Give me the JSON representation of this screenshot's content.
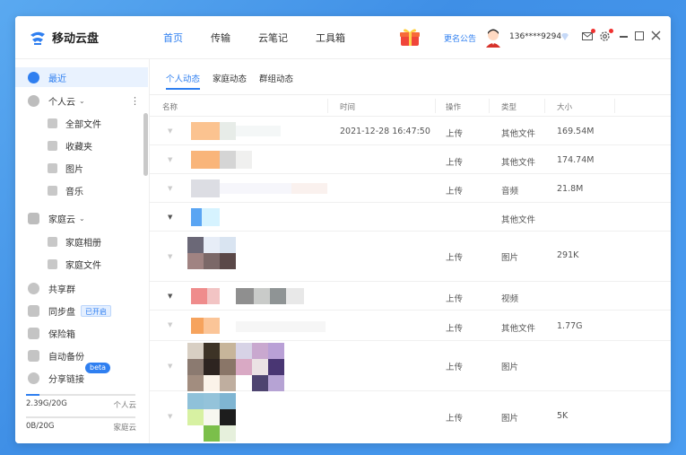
{
  "app": {
    "name": "移动云盘",
    "accent": "#2f7ff0"
  },
  "topnav": [
    {
      "label": "首页",
      "active": true
    },
    {
      "label": "传输",
      "active": false
    },
    {
      "label": "云笔记",
      "active": false
    },
    {
      "label": "工具箱",
      "active": false
    }
  ],
  "header": {
    "notice": "更名公告",
    "phone": "136****9294"
  },
  "sidebar": {
    "recent": "最近",
    "personal_cloud": "个人云",
    "all_files": "全部文件",
    "favorites": "收藏夹",
    "pictures": "图片",
    "music": "音乐",
    "family_cloud": "家庭云",
    "family_album": "家庭相册",
    "family_files": "家庭文件",
    "shared_group": "共享群",
    "sync_disk": "同步盘",
    "sync_badge": "已开启",
    "safe_box": "保险箱",
    "auto_backup": "自动备份",
    "beta": "beta",
    "share_link": "分享链接",
    "quota_personal": {
      "text": "2.39G/20G",
      "kind": "个人云",
      "fill": 0.12
    },
    "quota_family": {
      "text": "0B/20G",
      "kind": "家庭云",
      "fill": 0.0
    }
  },
  "tabs": [
    {
      "label": "个人动态",
      "active": true
    },
    {
      "label": "家庭动态",
      "active": false
    },
    {
      "label": "群组动态",
      "active": false
    }
  ],
  "table": {
    "headers": [
      "名称",
      "时间",
      "操作",
      "类型",
      "大小"
    ],
    "rows": [
      {
        "time": "2021-12-28 16:47:50",
        "action": "上传",
        "type": "其他文件",
        "size": "169.54M"
      },
      {
        "time": "",
        "action": "上传",
        "type": "其他文件",
        "size": "174.74M"
      },
      {
        "time": "",
        "action": "上传",
        "type": "音频",
        "size": "21.8M"
      },
      {
        "time": "",
        "action": "",
        "type": "其他文件",
        "size": ""
      },
      {
        "time": "",
        "action": "上传",
        "type": "图片",
        "size": "291K"
      },
      {
        "time": "",
        "action": "上传",
        "type": "视频",
        "size": ""
      },
      {
        "time": "",
        "action": "上传",
        "type": "其他文件",
        "size": "1.77G"
      },
      {
        "time": "",
        "action": "上传",
        "type": "图片",
        "size": ""
      },
      {
        "time": "",
        "action": "上传",
        "type": "图片",
        "size": "5K"
      }
    ]
  }
}
